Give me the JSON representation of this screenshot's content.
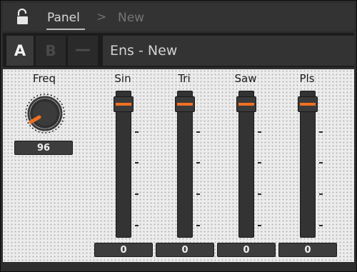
{
  "breadcrumb": {
    "root": "Panel",
    "separator": ">",
    "current": "New"
  },
  "header": {
    "btn_a": "A",
    "btn_b": "B",
    "btn_minus": "—",
    "title": "Ens - New"
  },
  "knob": {
    "label": "Freq",
    "value": "96",
    "accent": "#f07022"
  },
  "sliders": [
    {
      "label": "Sin",
      "value": "0",
      "level": 1.0
    },
    {
      "label": "Tri",
      "value": "0",
      "level": 1.0
    },
    {
      "label": "Saw",
      "value": "0",
      "level": 1.0
    },
    {
      "label": "Pls",
      "value": "0",
      "level": 1.0
    }
  ],
  "icons": {
    "lock": "unlocked-padlock-icon"
  },
  "colors": {
    "accent": "#f07022",
    "panel": "#ececec",
    "dark": "#333333"
  }
}
